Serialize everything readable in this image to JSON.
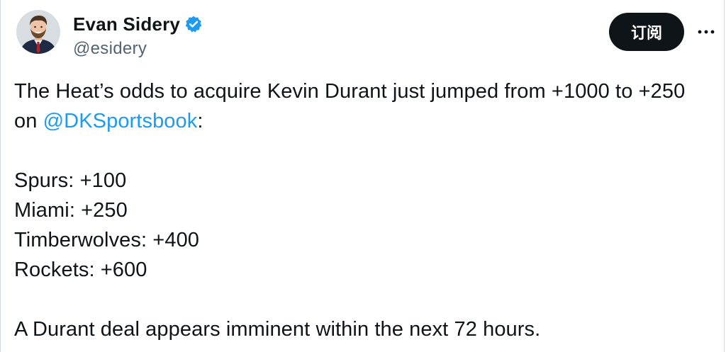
{
  "author": {
    "display_name": "Evan Sidery",
    "handle": "@esidery",
    "verified": true,
    "avatar_icon": "person-avatar",
    "verified_icon": "verified-badge-icon"
  },
  "actions": {
    "subscribe_label": "订阅",
    "more_icon": "more-options-icon"
  },
  "tweet": {
    "line1_before_mention": "The Heat’s odds to acquire Kevin Durant just jumped from +1000 to +250 on ",
    "mention": "@DKSportsbook",
    "line1_after_mention": ":",
    "odds": [
      "Spurs: +100",
      "Miami: +250",
      "Timberwolves: +400",
      "Rockets: +600"
    ],
    "closing": "A Durant deal appears imminent within the next 72 hours."
  },
  "colors": {
    "link": "#1d9bf0",
    "verified": "#1d9bf0",
    "text": "#0f1419",
    "secondary": "#536471",
    "button_bg": "#0f1419"
  }
}
